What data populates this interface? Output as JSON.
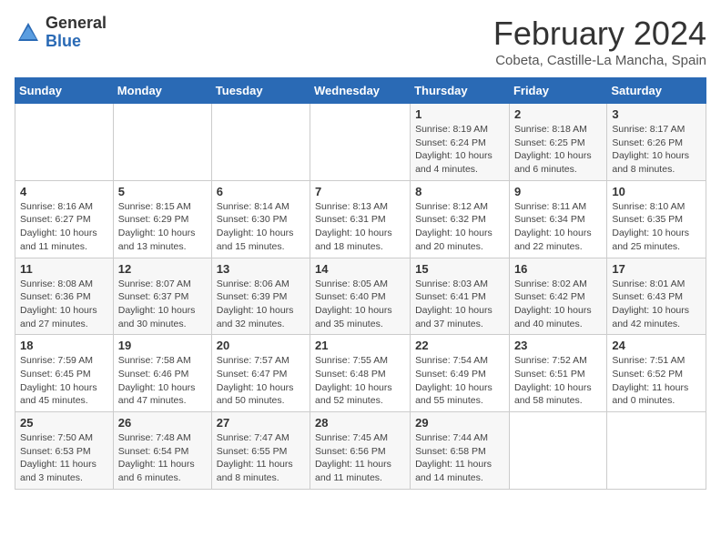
{
  "logo": {
    "general": "General",
    "blue": "Blue"
  },
  "title": "February 2024",
  "subtitle": "Cobeta, Castille-La Mancha, Spain",
  "days_header": [
    "Sunday",
    "Monday",
    "Tuesday",
    "Wednesday",
    "Thursday",
    "Friday",
    "Saturday"
  ],
  "weeks": [
    [
      {
        "num": "",
        "info": ""
      },
      {
        "num": "",
        "info": ""
      },
      {
        "num": "",
        "info": ""
      },
      {
        "num": "",
        "info": ""
      },
      {
        "num": "1",
        "info": "Sunrise: 8:19 AM\nSunset: 6:24 PM\nDaylight: 10 hours and 4 minutes."
      },
      {
        "num": "2",
        "info": "Sunrise: 8:18 AM\nSunset: 6:25 PM\nDaylight: 10 hours and 6 minutes."
      },
      {
        "num": "3",
        "info": "Sunrise: 8:17 AM\nSunset: 6:26 PM\nDaylight: 10 hours and 8 minutes."
      }
    ],
    [
      {
        "num": "4",
        "info": "Sunrise: 8:16 AM\nSunset: 6:27 PM\nDaylight: 10 hours and 11 minutes."
      },
      {
        "num": "5",
        "info": "Sunrise: 8:15 AM\nSunset: 6:29 PM\nDaylight: 10 hours and 13 minutes."
      },
      {
        "num": "6",
        "info": "Sunrise: 8:14 AM\nSunset: 6:30 PM\nDaylight: 10 hours and 15 minutes."
      },
      {
        "num": "7",
        "info": "Sunrise: 8:13 AM\nSunset: 6:31 PM\nDaylight: 10 hours and 18 minutes."
      },
      {
        "num": "8",
        "info": "Sunrise: 8:12 AM\nSunset: 6:32 PM\nDaylight: 10 hours and 20 minutes."
      },
      {
        "num": "9",
        "info": "Sunrise: 8:11 AM\nSunset: 6:34 PM\nDaylight: 10 hours and 22 minutes."
      },
      {
        "num": "10",
        "info": "Sunrise: 8:10 AM\nSunset: 6:35 PM\nDaylight: 10 hours and 25 minutes."
      }
    ],
    [
      {
        "num": "11",
        "info": "Sunrise: 8:08 AM\nSunset: 6:36 PM\nDaylight: 10 hours and 27 minutes."
      },
      {
        "num": "12",
        "info": "Sunrise: 8:07 AM\nSunset: 6:37 PM\nDaylight: 10 hours and 30 minutes."
      },
      {
        "num": "13",
        "info": "Sunrise: 8:06 AM\nSunset: 6:39 PM\nDaylight: 10 hours and 32 minutes."
      },
      {
        "num": "14",
        "info": "Sunrise: 8:05 AM\nSunset: 6:40 PM\nDaylight: 10 hours and 35 minutes."
      },
      {
        "num": "15",
        "info": "Sunrise: 8:03 AM\nSunset: 6:41 PM\nDaylight: 10 hours and 37 minutes."
      },
      {
        "num": "16",
        "info": "Sunrise: 8:02 AM\nSunset: 6:42 PM\nDaylight: 10 hours and 40 minutes."
      },
      {
        "num": "17",
        "info": "Sunrise: 8:01 AM\nSunset: 6:43 PM\nDaylight: 10 hours and 42 minutes."
      }
    ],
    [
      {
        "num": "18",
        "info": "Sunrise: 7:59 AM\nSunset: 6:45 PM\nDaylight: 10 hours and 45 minutes."
      },
      {
        "num": "19",
        "info": "Sunrise: 7:58 AM\nSunset: 6:46 PM\nDaylight: 10 hours and 47 minutes."
      },
      {
        "num": "20",
        "info": "Sunrise: 7:57 AM\nSunset: 6:47 PM\nDaylight: 10 hours and 50 minutes."
      },
      {
        "num": "21",
        "info": "Sunrise: 7:55 AM\nSunset: 6:48 PM\nDaylight: 10 hours and 52 minutes."
      },
      {
        "num": "22",
        "info": "Sunrise: 7:54 AM\nSunset: 6:49 PM\nDaylight: 10 hours and 55 minutes."
      },
      {
        "num": "23",
        "info": "Sunrise: 7:52 AM\nSunset: 6:51 PM\nDaylight: 10 hours and 58 minutes."
      },
      {
        "num": "24",
        "info": "Sunrise: 7:51 AM\nSunset: 6:52 PM\nDaylight: 11 hours and 0 minutes."
      }
    ],
    [
      {
        "num": "25",
        "info": "Sunrise: 7:50 AM\nSunset: 6:53 PM\nDaylight: 11 hours and 3 minutes."
      },
      {
        "num": "26",
        "info": "Sunrise: 7:48 AM\nSunset: 6:54 PM\nDaylight: 11 hours and 6 minutes."
      },
      {
        "num": "27",
        "info": "Sunrise: 7:47 AM\nSunset: 6:55 PM\nDaylight: 11 hours and 8 minutes."
      },
      {
        "num": "28",
        "info": "Sunrise: 7:45 AM\nSunset: 6:56 PM\nDaylight: 11 hours and 11 minutes."
      },
      {
        "num": "29",
        "info": "Sunrise: 7:44 AM\nSunset: 6:58 PM\nDaylight: 11 hours and 14 minutes."
      },
      {
        "num": "",
        "info": ""
      },
      {
        "num": "",
        "info": ""
      }
    ]
  ]
}
